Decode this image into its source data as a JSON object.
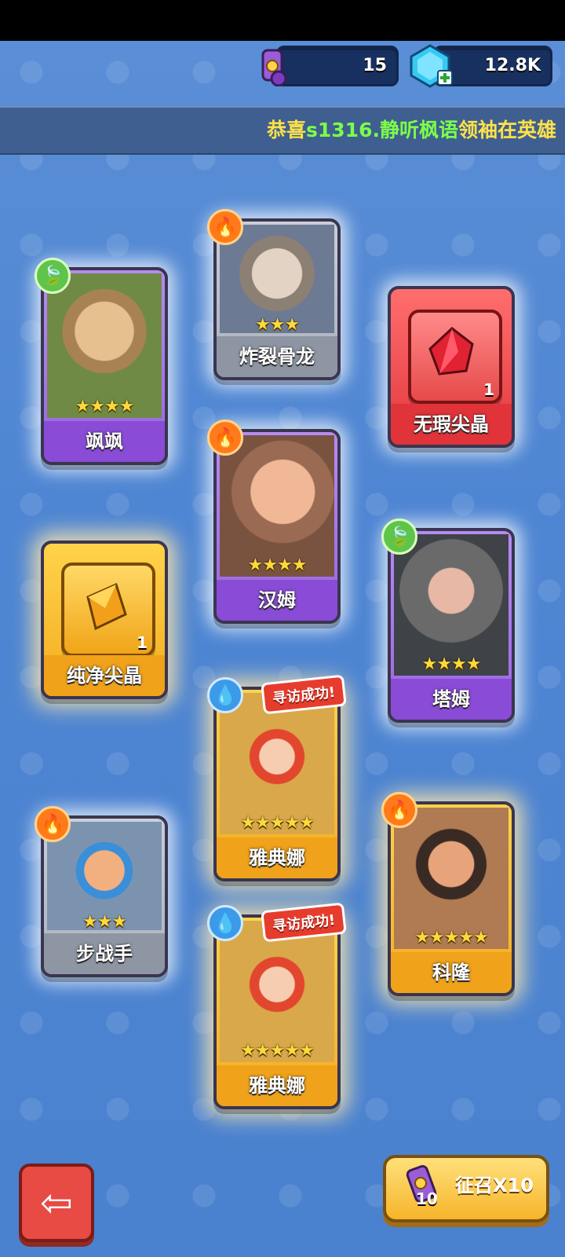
{
  "currency": {
    "scroll_count": "15",
    "gem_count": "12.8K"
  },
  "ticker": {
    "message": "恭喜",
    "player": "s1316.静听枫语",
    "suffix": "领袖在英雄"
  },
  "cards": [
    {
      "name": "飒飒",
      "stars": "★★★★",
      "element": "leaf"
    },
    {
      "name": "炸裂骨龙",
      "stars": "★★★",
      "element": "fire"
    },
    {
      "name": "无瑕尖晶",
      "qty": "1"
    },
    {
      "name": "汉姆",
      "stars": "★★★★",
      "element": "fire"
    },
    {
      "name": "纯净尖晶",
      "qty": "1"
    },
    {
      "name": "塔姆",
      "stars": "★★★★",
      "element": "leaf"
    },
    {
      "name": "雅典娜",
      "stars": "★★★★★",
      "element": "water",
      "badge": "寻访成功!"
    },
    {
      "name": "步战手",
      "stars": "★★★",
      "element": "fire"
    },
    {
      "name": "科隆",
      "stars": "★★★★★",
      "element": "fire"
    },
    {
      "name": "雅典娜",
      "stars": "★★★★★",
      "element": "water",
      "badge": "寻访成功!"
    }
  ],
  "buttons": {
    "back_icon": "⇦",
    "recruit_label": "征召X10",
    "recruit_count": "10"
  },
  "colors": {
    "accent_gold": "#f6b52a",
    "ticker_green": "#7cff4a",
    "ticker_yellow": "#ffe14a"
  }
}
